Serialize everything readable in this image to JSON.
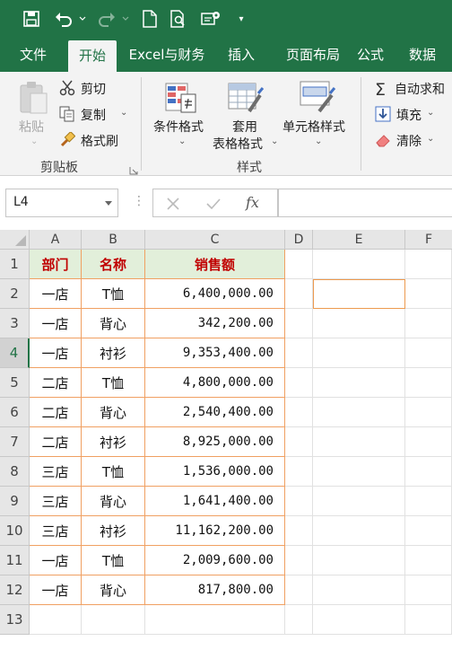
{
  "qat": {
    "customize_glyph": "▾"
  },
  "tabs": [
    {
      "label": "文件",
      "active": false
    },
    {
      "label": "开始",
      "active": true
    },
    {
      "label": "Excel与财务",
      "active": false
    },
    {
      "label": "插入",
      "active": false
    },
    {
      "label": "页面布局",
      "active": false
    },
    {
      "label": "公式",
      "active": false
    },
    {
      "label": "数据",
      "active": false
    }
  ],
  "ribbon": {
    "clipboard": {
      "paste": "粘贴",
      "cut": "剪切",
      "copy": "复制",
      "format_painter": "格式刷",
      "group_label": "剪贴板"
    },
    "styles": {
      "conditional_format": "条件格式",
      "table_format_1": "套用",
      "table_format_2": "表格格式",
      "cell_styles": "单元格样式",
      "group_label": "样式"
    },
    "editing": {
      "autosum": "自动求和",
      "fill": "填充",
      "clear": "清除"
    }
  },
  "formula_bar": {
    "name_box": "L4",
    "fx_label": "fx",
    "formula": ""
  },
  "columns": [
    "A",
    "B",
    "C",
    "D",
    "E",
    "F"
  ],
  "rows": [
    "1",
    "2",
    "3",
    "4",
    "5",
    "6",
    "7",
    "8",
    "9",
    "10",
    "11",
    "12",
    "13"
  ],
  "table": {
    "headers": [
      "部门",
      "名称",
      "销售额"
    ],
    "data": [
      [
        "一店",
        "T恤",
        "6,400,000.00"
      ],
      [
        "一店",
        "背心",
        "342,200.00"
      ],
      [
        "一店",
        "衬衫",
        "9,353,400.00"
      ],
      [
        "二店",
        "T恤",
        "4,800,000.00"
      ],
      [
        "二店",
        "背心",
        "2,540,400.00"
      ],
      [
        "二店",
        "衬衫",
        "8,925,000.00"
      ],
      [
        "三店",
        "T恤",
        "1,536,000.00"
      ],
      [
        "三店",
        "背心",
        "1,641,400.00"
      ],
      [
        "三店",
        "衬衫",
        "11,162,200.00"
      ],
      [
        "一店",
        "T恤",
        "2,009,600.00"
      ],
      [
        "一店",
        "背心",
        "817,800.00"
      ]
    ]
  },
  "colors": {
    "excel_green": "#217346",
    "header_text": "#c00000",
    "header_fill": "#e2efda",
    "table_border": "#f0a062"
  }
}
